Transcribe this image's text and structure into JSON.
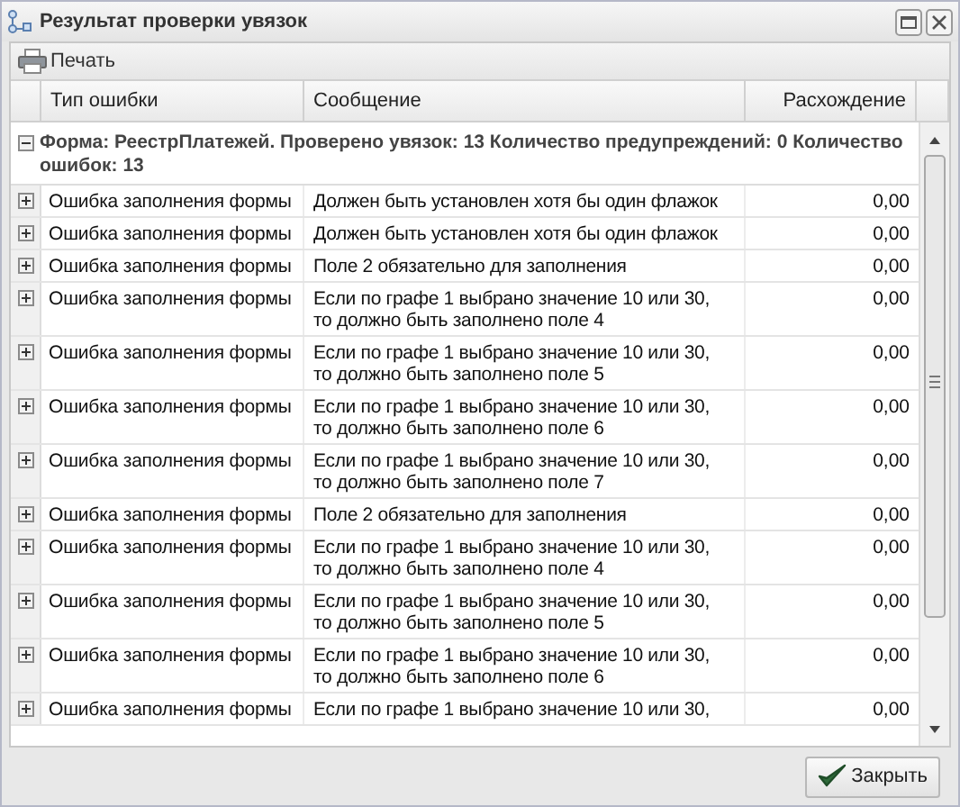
{
  "window": {
    "title": "Результат проверки увязок"
  },
  "toolbar": {
    "print_button": "Печать"
  },
  "table": {
    "columns": [
      "Тип ошибки",
      "Сообщение",
      "Расхождение"
    ],
    "group": {
      "label": "Форма: РеестрПлатежей. Проверено увязок: 13 Количество предупреждений: 0 Количество ошибок: 13",
      "expanded": true
    },
    "rows": [
      {
        "type": "Ошибка заполнения формы",
        "message": "Должен быть установлен хотя бы один флажок",
        "difference": "0,00",
        "expanded": false
      },
      {
        "type": "Ошибка заполнения формы",
        "message": "Должен быть установлен хотя бы один флажок",
        "difference": "0,00",
        "expanded": false
      },
      {
        "type": "Ошибка заполнения формы",
        "message": "Поле 2 обязательно для заполнения",
        "difference": "0,00",
        "expanded": false
      },
      {
        "type": "Ошибка заполнения формы",
        "message": "Если по графе 1 выбрано значение 10 или 30, то должно быть заполнено поле 4",
        "difference": "0,00",
        "expanded": false
      },
      {
        "type": "Ошибка заполнения формы",
        "message": "Если по графе 1 выбрано значение 10 или 30, то должно быть заполнено поле 5",
        "difference": "0,00",
        "expanded": false
      },
      {
        "type": "Ошибка заполнения формы",
        "message": "Если по графе 1 выбрано значение 10 или 30, то должно быть заполнено поле 6",
        "difference": "0,00",
        "expanded": false
      },
      {
        "type": "Ошибка заполнения формы",
        "message": "Если по графе 1 выбрано значение 10 или 30, то должно быть заполнено поле 7",
        "difference": "0,00",
        "expanded": false
      },
      {
        "type": "Ошибка заполнения формы",
        "message": "Поле 2 обязательно для заполнения",
        "difference": "0,00",
        "expanded": false
      },
      {
        "type": "Ошибка заполнения формы",
        "message": "Если по графе 1 выбрано значение 10 или 30, то должно быть заполнено поле 4",
        "difference": "0,00",
        "expanded": false
      },
      {
        "type": "Ошибка заполнения формы",
        "message": "Если по графе 1 выбрано значение 10 или 30, то должно быть заполнено поле 5",
        "difference": "0,00",
        "expanded": false
      },
      {
        "type": "Ошибка заполнения формы",
        "message": "Если по графе 1 выбрано значение 10 или 30, то должно быть заполнено поле 6",
        "difference": "0,00",
        "expanded": false
      },
      {
        "type": "Ошибка заполнения формы",
        "message": "Если по графе 1 выбрано значение 10 или 30,",
        "difference": "0,00",
        "expanded": false
      }
    ]
  },
  "footer": {
    "close_button": "Закрыть"
  }
}
